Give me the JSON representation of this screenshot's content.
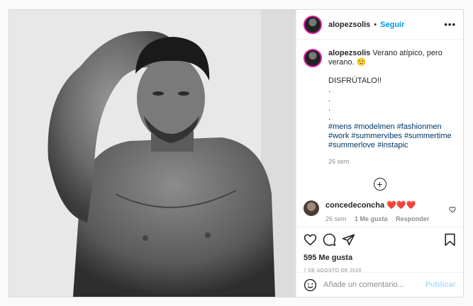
{
  "post": {
    "username": "alopezsolis",
    "separator": "•",
    "follow_label": "Seguir",
    "more_label": "•••"
  },
  "caption": {
    "username": "alopezsolis",
    "text_line1": "Verano atípico, pero verano. 🙂",
    "disfrutalo": "DISFRÚTALO!!",
    "dots": [
      ".",
      ".",
      ".",
      "."
    ],
    "hashtags": [
      "#mens",
      "#modelmen",
      "#fashionmen",
      "#work",
      "#summervibes",
      "#summertime",
      "#summerlove",
      "#instapic"
    ],
    "time": "26 sem"
  },
  "load_more_label": "+",
  "comment": {
    "username": "concedeconcha",
    "text": "❤️❤️❤️",
    "time": "26 sem",
    "likes": "1 Me gusta",
    "reply": "Responder"
  },
  "likes_label": "595 Me gusta",
  "date_label": "7 DE AGOSTO DE 2020",
  "add_comment": {
    "placeholder": "Añade un comentario...",
    "publish_label": "Publicar"
  },
  "colors": {
    "accent": "#0095f6",
    "hashtag": "#00376b",
    "muted": "#8e8e8e"
  }
}
